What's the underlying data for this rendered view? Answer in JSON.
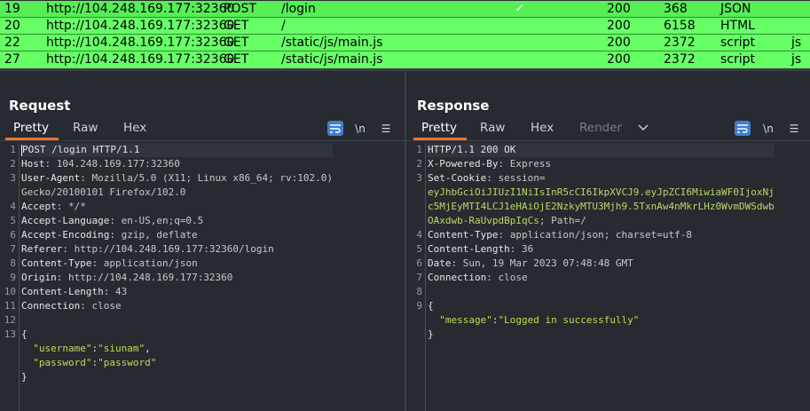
{
  "history": {
    "rows": [
      {
        "num": "19",
        "host": "http://104.248.169.177:32360",
        "method": "POST",
        "url": "/login",
        "check": "✓",
        "status": "200",
        "length": "368",
        "mime": "JSON",
        "ext": ""
      },
      {
        "num": "20",
        "host": "http://104.248.169.177:32360",
        "method": "GET",
        "url": "/",
        "check": "",
        "status": "200",
        "length": "6158",
        "mime": "HTML",
        "ext": ""
      },
      {
        "num": "22",
        "host": "http://104.248.169.177:32360",
        "method": "GET",
        "url": "/static/js/main.js",
        "check": "",
        "status": "200",
        "length": "2372",
        "mime": "script",
        "ext": "js"
      },
      {
        "num": "27",
        "host": "http://104.248.169.177:32360",
        "method": "GET",
        "url": "/static/js/main.js",
        "check": "",
        "status": "200",
        "length": "2372",
        "mime": "script",
        "ext": "js"
      }
    ]
  },
  "request": {
    "title": "Request",
    "tabs": [
      "Pretty",
      "Raw",
      "Hex"
    ],
    "newline_label": "\\n",
    "menu_label": "☰",
    "lines": [
      {
        "n": "1",
        "k": "POST /login HTTP/1.1",
        "v": ""
      },
      {
        "n": "2",
        "k": "Host",
        "v": ": 104.248.169.177:32360"
      },
      {
        "n": "3",
        "k": "User-Agent",
        "v": ": Mozilla/5.0 (X11; Linux x86_64; rv:102.0)"
      },
      {
        "n": "",
        "k": "",
        "v": "Gecko/20100101 Firefox/102.0"
      },
      {
        "n": "4",
        "k": "Accept",
        "v": ": */*"
      },
      {
        "n": "5",
        "k": "Accept-Language",
        "v": ": en-US,en;q=0.5"
      },
      {
        "n": "6",
        "k": "Accept-Encoding",
        "v": ": gzip, deflate"
      },
      {
        "n": "7",
        "k": "Referer",
        "v": ": http://104.248.169.177:32360/login"
      },
      {
        "n": "8",
        "k": "Content-Type",
        "v": ": application/json"
      },
      {
        "n": "9",
        "k": "Origin",
        "v": ": http://104.248.169.177:32360"
      },
      {
        "n": "10",
        "k": "Content-Length",
        "v": ": 43"
      },
      {
        "n": "11",
        "k": "Connection",
        "v": ": close"
      },
      {
        "n": "12",
        "k": "",
        "v": ""
      },
      {
        "n": "13",
        "k": "{",
        "v": ""
      }
    ],
    "body": {
      "username_key": "\"username\"",
      "username_val": "\"siunam\"",
      "password_key": "\"password\"",
      "password_val": "\"password\"",
      "close": "}"
    }
  },
  "response": {
    "title": "Response",
    "tabs": [
      "Pretty",
      "Raw",
      "Hex",
      "Render"
    ],
    "newline_label": "\\n",
    "menu_label": "☰",
    "lines": [
      {
        "n": "1",
        "k": "HTTP/1.1 200 OK",
        "v": ""
      },
      {
        "n": "2",
        "k": "X-Powered-By",
        "v": ": Express"
      },
      {
        "n": "3",
        "k": "Set-Cookie",
        "v": ": session="
      }
    ],
    "cookie_lines": [
      "eyJhbGciOiJIUzI1NiIsInR5cCI6IkpXVCJ9.eyJpZCI6MiwiaWF0IjoxNj",
      "c5MjEyMTI4LCJ1eHAiOjE2NzkyMTU3Mjh9.5TxnAw4nMkrLHz0WvmDWSdwb",
      "OAxdwb-RaUvpdBpIqCs"
    ],
    "cookie_tail": "; Path=/",
    "lines2": [
      {
        "n": "4",
        "k": "Content-Type",
        "v": ": application/json; charset=utf-8"
      },
      {
        "n": "5",
        "k": "Content-Length",
        "v": ": 36"
      },
      {
        "n": "6",
        "k": "Date",
        "v": ": Sun, 19 Mar 2023 07:48:48 GMT"
      },
      {
        "n": "7",
        "k": "Connection",
        "v": ": close"
      },
      {
        "n": "8",
        "k": "",
        "v": ""
      },
      {
        "n": "9",
        "k": "{",
        "v": ""
      }
    ],
    "body": {
      "message_key": "\"message\"",
      "message_val": "\"Logged in successfully\"",
      "close": "}"
    }
  },
  "colors": {
    "row_green": "#66ff66",
    "accent_blue": "#3f7fd0",
    "tab_underline": "#e8762f",
    "background": "#272a30"
  }
}
